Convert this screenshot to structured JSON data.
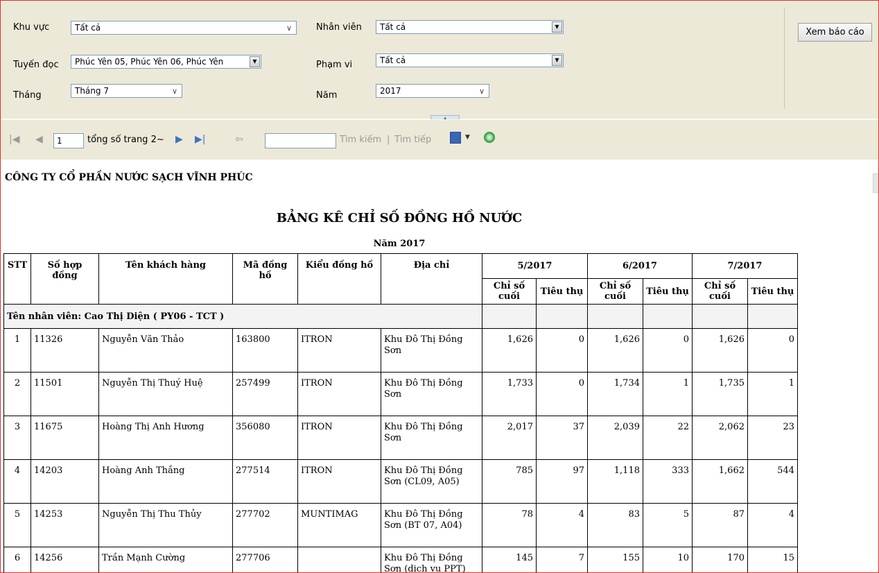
{
  "params": {
    "khu_vuc_label": "Khu vực",
    "khu_vuc_value": "Tất cả",
    "tuyen_doc_label": "Tuyến đọc",
    "tuyen_doc_value": "Phúc Yên 05, Phúc Yên 06, Phúc Yên",
    "thang_label": "Tháng",
    "thang_value": "Tháng 7",
    "nhan_vien_label": "Nhân viên",
    "nhan_vien_value": "Tất cả",
    "pham_vi_label": "Phạm vi",
    "pham_vi_value": "Tất cả",
    "nam_label": "Năm",
    "nam_value": "2017",
    "view_button": "Xem báo cáo"
  },
  "toolbar": {
    "page_current": "1",
    "total_pages": "tổng số trang 2~",
    "search_placeholder": "",
    "find_label": "Tìm kiếm",
    "separator": "|",
    "find_next_label": "Tìm tiếp"
  },
  "report": {
    "company": "CÔNG TY CỔ PHẦN NƯỚC SẠCH VĨNH PHÚC",
    "title": "BẢNG KÊ CHỈ SỐ ĐỒNG HỒ NƯỚC",
    "year_line": "Năm 2017",
    "headers": {
      "stt": "STT",
      "contract": "Số hợp đồng",
      "customer": "Tên khách hàng",
      "meter_code": "Mã đồng hồ",
      "meter_type": "Kiểu đồng hồ",
      "address": "Địa chỉ",
      "periods": [
        "5/2017",
        "6/2017",
        "7/2017"
      ],
      "last_index": "Chỉ số cuối",
      "consumption": "Tiêu thụ"
    },
    "group_label": "Tên nhân viên: Cao Thị Diện ( PY06 - TCT )",
    "rows": [
      {
        "stt": "1",
        "contract": "11326",
        "name": "Nguyễn Văn Thảo",
        "meter": "163800",
        "type": "ITRON",
        "address": "Khu Đô Thị Đồng Sơn",
        "v": [
          "1,626",
          "0",
          "1,626",
          "0",
          "1,626",
          "0"
        ]
      },
      {
        "stt": "2",
        "contract": "11501",
        "name": "Nguyễn Thị Thuý Huệ",
        "meter": "257499",
        "type": "ITRON",
        "address": "Khu Đô Thị Đồng Sơn",
        "v": [
          "1,733",
          "0",
          "1,734",
          "1",
          "1,735",
          "1"
        ]
      },
      {
        "stt": "3",
        "contract": "11675",
        "name": "Hoàng Thị Anh Hương",
        "meter": "356080",
        "type": "ITRON",
        "address": "Khu Đô Thị Đồng Sơn",
        "v": [
          "2,017",
          "37",
          "2,039",
          "22",
          "2,062",
          "23"
        ]
      },
      {
        "stt": "4",
        "contract": "14203",
        "name": "Hoàng Anh Thắng",
        "meter": "277514",
        "type": "ITRON",
        "address": "Khu Đô Thị Đồng Sơn (CL09, A05)",
        "v": [
          "785",
          "97",
          "1,118",
          "333",
          "1,662",
          "544"
        ]
      },
      {
        "stt": "5",
        "contract": "14253",
        "name": "Nguyễn Thị Thu Thủy",
        "meter": "277702",
        "type": "MUNTIMAG",
        "address": "Khu Đô Thị Đồng Sơn (BT 07, A04)",
        "v": [
          "78",
          "4",
          "83",
          "5",
          "87",
          "4"
        ]
      },
      {
        "stt": "6",
        "contract": "14256",
        "name": "Trần Mạnh Cường",
        "meter": "277706",
        "type": "",
        "address": "Khu Đô Thị Đồng Sơn (dịch vụ PPT)",
        "v": [
          "145",
          "7",
          "155",
          "10",
          "170",
          "15"
        ]
      }
    ]
  }
}
